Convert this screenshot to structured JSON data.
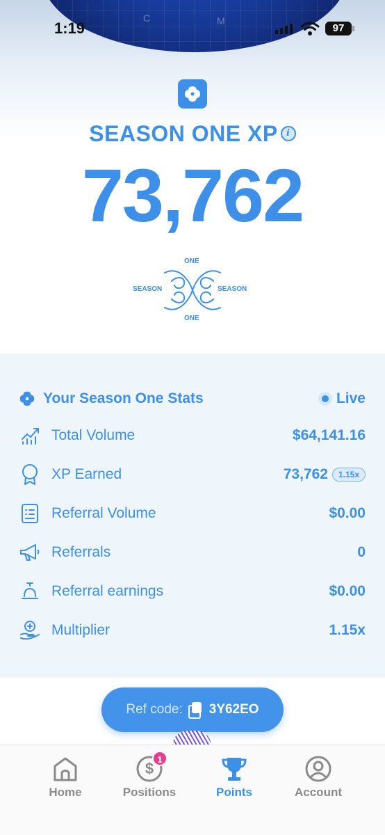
{
  "status_bar": {
    "time": "1:19",
    "battery": "97"
  },
  "hero": {
    "title": "SEASON ONE XP",
    "xp_total": "73,762",
    "emblem_top": "ONE",
    "emblem_bottom": "ONE",
    "emblem_left": "SEASON",
    "emblem_right": "SEASON"
  },
  "stats": {
    "heading": "Your Season One Stats",
    "live_label": "Live",
    "rows": [
      {
        "label": "Total Volume",
        "value": "$64,141.16",
        "icon": "chart-up-icon"
      },
      {
        "label": "XP Earned",
        "value": "73,762",
        "badge": "1.15x",
        "icon": "award-ribbon-icon"
      },
      {
        "label": "Referral Volume",
        "value": "$0.00",
        "icon": "list-document-icon"
      },
      {
        "label": "Referrals",
        "value": "0",
        "icon": "megaphone-icon"
      },
      {
        "label": "Referral earnings",
        "value": "$0.00",
        "icon": "bell-stand-icon"
      },
      {
        "label": "Multiplier",
        "value": "1.15x",
        "icon": "hand-coin-icon"
      }
    ]
  },
  "ref_code": {
    "label": "Ref code:",
    "code": "3Y62EO"
  },
  "tabs": [
    {
      "label": "Home",
      "icon": "home-icon",
      "active": false
    },
    {
      "label": "Positions",
      "icon": "dollar-circle-icon",
      "badge": "1",
      "active": false
    },
    {
      "label": "Points",
      "icon": "trophy-icon",
      "active": true
    },
    {
      "label": "Account",
      "icon": "user-circle-icon",
      "active": false
    }
  ],
  "colors": {
    "accent": "#3d8fe8",
    "panel": "#eef6fc",
    "badge": "#e83d8c",
    "inactive": "#8a8a8a"
  }
}
